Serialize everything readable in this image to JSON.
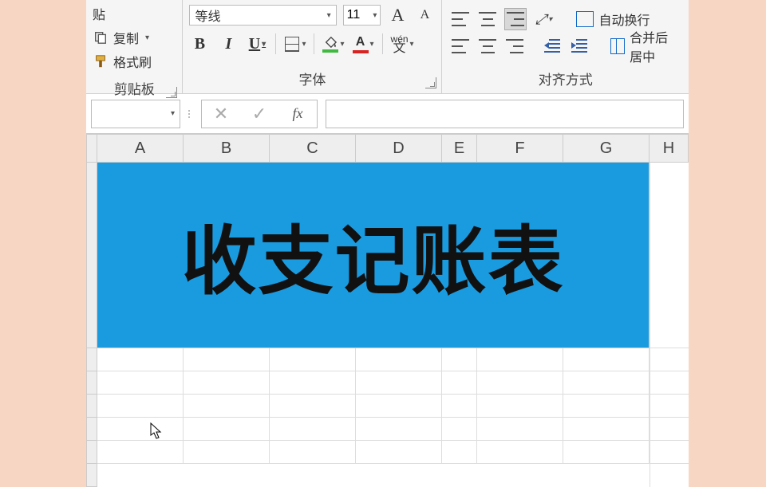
{
  "clipboard": {
    "copy_label": "复制",
    "format_painter_label": "格式刷",
    "paste_suffix": "贴",
    "group_label": "剪贴板"
  },
  "font": {
    "name": "等线",
    "size": "11",
    "inc_label": "A",
    "dec_label": "A",
    "bold": "B",
    "italic": "I",
    "underline": "U",
    "font_color_letter": "A",
    "wen_top": "wén",
    "wen_bottom": "文",
    "group_label": "字体"
  },
  "align": {
    "wrap_label": "自动换行",
    "merge_label": "合并后居中",
    "group_label": "对齐方式"
  },
  "sheet": {
    "columns": [
      "A",
      "B",
      "C",
      "D",
      "E",
      "F",
      "G",
      "H"
    ],
    "title": "收支记账表"
  }
}
